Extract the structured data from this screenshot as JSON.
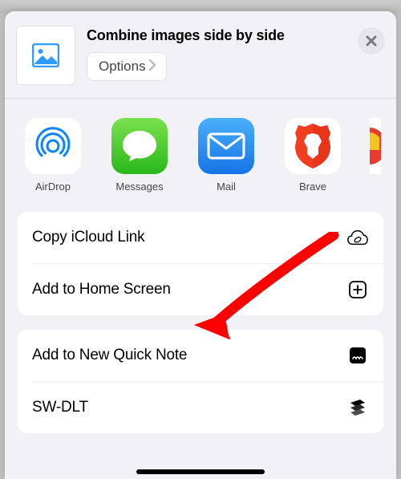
{
  "header": {
    "title": "Combine images side by side",
    "options_label": "Options"
  },
  "apps": {
    "airdrop": "AirDrop",
    "messages": "Messages",
    "mail": "Mail",
    "brave": "Brave"
  },
  "actions": {
    "copy_icloud": "Copy iCloud Link",
    "add_home": "Add to Home Screen",
    "quick_note": "Add to New Quick Note",
    "sw_dlt": "SW-DLT"
  }
}
